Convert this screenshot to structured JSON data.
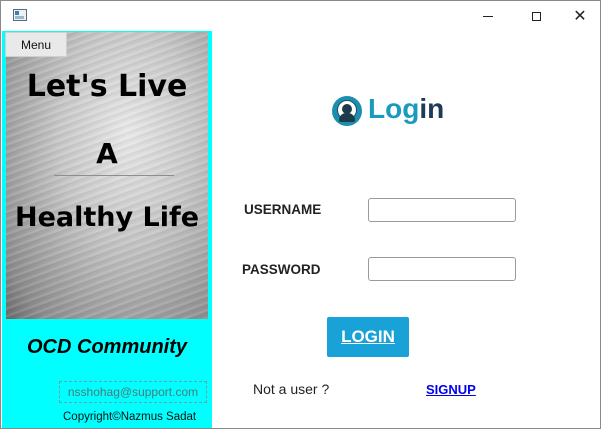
{
  "window": {
    "icon": "app-window-icon",
    "controls": {
      "minimize_icon": "minimize-icon",
      "maximize_icon": "maximize-icon",
      "close_icon": "close-icon",
      "close_glyph": "✕"
    }
  },
  "left_panel": {
    "menu_label": "Menu",
    "hero_lines": [
      "Let's Live",
      "A",
      "Healthy Life"
    ],
    "community": "OCD Community",
    "email": "nsshohag@support.com",
    "copyright": "Copyright©Nazmus Sadat",
    "accent_color": "#00ffff"
  },
  "login_form": {
    "logo_text_primary": "Log",
    "logo_text_tail": "in",
    "username_label": "USERNAME",
    "username_value": "",
    "password_label": "PASSWORD",
    "password_value": "",
    "login_button": "LOGIN",
    "not_user_text": "Not a user ?",
    "signup_link": "SIGNUP",
    "button_color": "#19a2d8",
    "logo_color": "#1a9bbd"
  }
}
